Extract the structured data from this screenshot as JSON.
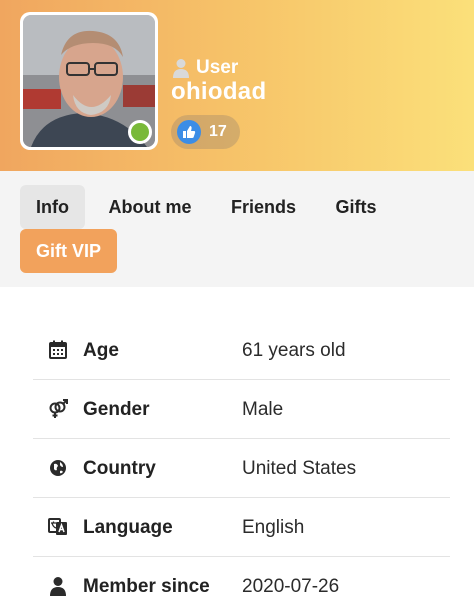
{
  "profile": {
    "role_label": "User",
    "username": "ohiodad",
    "likes_count": "17",
    "status": "online"
  },
  "tabs": [
    {
      "label": "Info",
      "active": true
    },
    {
      "label": "About me",
      "active": false
    },
    {
      "label": "Friends",
      "active": false
    },
    {
      "label": "Gifts",
      "active": false
    }
  ],
  "gift_vip_label": "Gift VIP",
  "info": [
    {
      "icon": "calendar-icon",
      "label": "Age",
      "value": "61 years old"
    },
    {
      "icon": "gender-icon",
      "label": "Gender",
      "value": "Male"
    },
    {
      "icon": "globe-icon",
      "label": "Country",
      "value": "United States"
    },
    {
      "icon": "language-icon",
      "label": "Language",
      "value": "English"
    },
    {
      "icon": "person-icon",
      "label": "Member since",
      "value": "2020-07-26"
    }
  ],
  "colors": {
    "header_start": "#f0a65f",
    "header_end": "#fbe07a",
    "accent": "#f2a25c",
    "online": "#79b939",
    "like": "#3c8de6"
  }
}
